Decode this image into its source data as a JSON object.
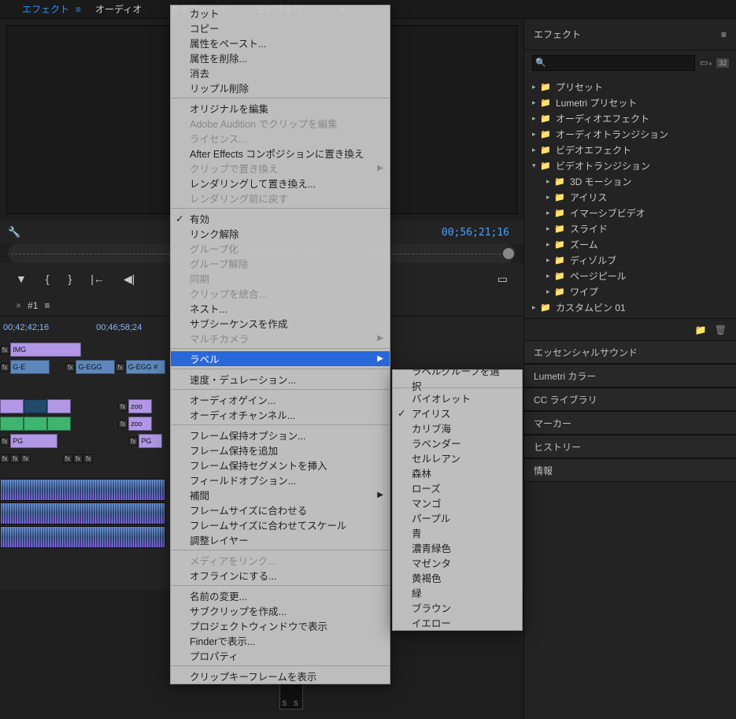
{
  "top_tabs": {
    "active": "エフェクト",
    "items": [
      "エフェクト",
      "オーディオ",
      "グラフィック",
      "ライブラリ"
    ],
    "overflow_icon": "»"
  },
  "program": {
    "timecode": "00;56;21;16"
  },
  "sequence": {
    "tab_close": "×",
    "tab_name": "#1",
    "ruler_times": [
      "00;42;42;16",
      "00;46;58;24"
    ],
    "clips": {
      "img": "IMG",
      "ge": "G-E",
      "gegg": "G-EGG",
      "gegg_hash": "G-EGG #",
      "pg": "PG",
      "zoo": "zoo"
    }
  },
  "effects_panel": {
    "title": "エフェクト",
    "badge": "32",
    "tree": [
      {
        "label": "プリセット",
        "expanded": false
      },
      {
        "label": "Lumetri プリセット",
        "expanded": false
      },
      {
        "label": "オーディオエフェクト",
        "expanded": false
      },
      {
        "label": "オーディオトランジション",
        "expanded": false
      },
      {
        "label": "ビデオエフェクト",
        "expanded": false
      },
      {
        "label": "ビデオトランジション",
        "expanded": true,
        "children": [
          "3D モーション",
          "アイリス",
          "イマーシブビデオ",
          "スライド",
          "ズーム",
          "ディゾルブ",
          "ページピール",
          "ワイプ"
        ]
      },
      {
        "label": "カスタムビン 01",
        "expanded": false
      }
    ]
  },
  "collapsed_panels": [
    "エッセンシャルサウンド",
    "Lumetri カラー",
    "CC ライブラリ",
    "マーカー",
    "ヒストリー",
    "情報"
  ],
  "audio_meter_label": "S  S",
  "context_menu": {
    "groups": [
      [
        {
          "label": "カット"
        },
        {
          "label": "コピー"
        },
        {
          "label": "属性をペースト..."
        },
        {
          "label": "属性を削除..."
        },
        {
          "label": "消去"
        },
        {
          "label": "リップル削除"
        }
      ],
      [
        {
          "label": "オリジナルを編集"
        },
        {
          "label": "Adobe Audition でクリップを編集",
          "disabled": true
        },
        {
          "label": "ライセンス...",
          "disabled": true
        },
        {
          "label": "After Effects コンポジションに置き換え"
        },
        {
          "label": "クリップで置き換え",
          "disabled": true,
          "sub": true
        },
        {
          "label": "レンダリングして置き換え..."
        },
        {
          "label": "レンダリング前に戻す",
          "disabled": true
        }
      ],
      [
        {
          "label": "有効",
          "checked": true
        },
        {
          "label": "リンク解除"
        },
        {
          "label": "グループ化",
          "disabled": true
        },
        {
          "label": "グループ解除",
          "disabled": true
        },
        {
          "label": "同期",
          "disabled": true
        },
        {
          "label": "クリップを統合...",
          "disabled": true
        },
        {
          "label": "ネスト..."
        },
        {
          "label": "サブシーケンスを作成"
        },
        {
          "label": "マルチカメラ",
          "disabled": true,
          "sub": true
        }
      ],
      [
        {
          "label": "ラベル",
          "sub": true,
          "highlighted": true
        }
      ],
      [
        {
          "label": "速度・デュレーション..."
        }
      ],
      [
        {
          "label": "オーディオゲイン..."
        },
        {
          "label": "オーディオチャンネル..."
        }
      ],
      [
        {
          "label": "フレーム保持オプション..."
        },
        {
          "label": "フレーム保持を追加"
        },
        {
          "label": "フレーム保持セグメントを挿入"
        },
        {
          "label": "フィールドオプション..."
        },
        {
          "label": "補間",
          "sub": true
        },
        {
          "label": "フレームサイズに合わせる"
        },
        {
          "label": "フレームサイズに合わせてスケール"
        },
        {
          "label": "調整レイヤー"
        }
      ],
      [
        {
          "label": "メディアをリンク...",
          "disabled": true
        },
        {
          "label": "オフラインにする..."
        }
      ],
      [
        {
          "label": "名前の変更..."
        },
        {
          "label": "サブクリップを作成..."
        },
        {
          "label": "プロジェクトウィンドウで表示"
        },
        {
          "label": "Finderで表示..."
        },
        {
          "label": "プロパティ"
        }
      ],
      [
        {
          "label": "クリップキーフレームを表示"
        }
      ]
    ]
  },
  "label_submenu": {
    "top": [
      {
        "label": "ラベルグループを選択"
      }
    ],
    "colors": [
      {
        "label": "バイオレット"
      },
      {
        "label": "アイリス",
        "checked": true
      },
      {
        "label": "カリブ海"
      },
      {
        "label": "ラベンダー"
      },
      {
        "label": "セルレアン"
      },
      {
        "label": "森林"
      },
      {
        "label": "ローズ"
      },
      {
        "label": "マンゴ"
      },
      {
        "label": "パープル"
      },
      {
        "label": "青"
      },
      {
        "label": "濃青緑色"
      },
      {
        "label": "マゼンタ"
      },
      {
        "label": "黄褐色"
      },
      {
        "label": "緑"
      },
      {
        "label": "ブラウン"
      },
      {
        "label": "イエロー"
      }
    ]
  }
}
